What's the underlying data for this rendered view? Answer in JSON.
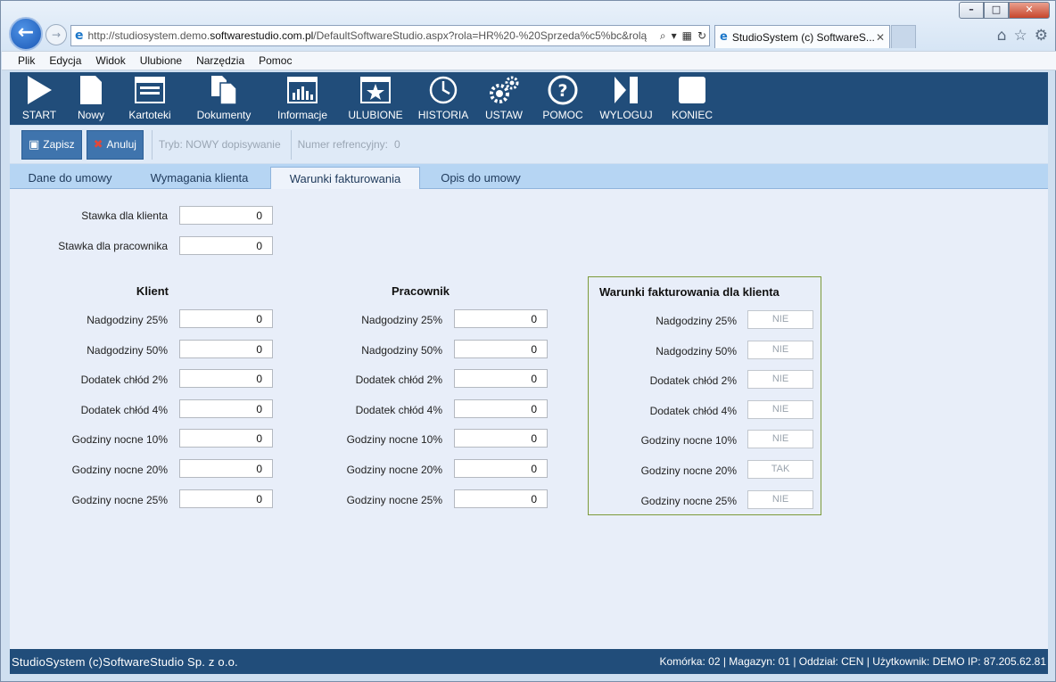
{
  "browser": {
    "url_prefix": "http://studiosystem.demo.",
    "url_domain": "softwarestudio.com.pl",
    "url_path": "/DefaultSoftwareStudio.aspx?rola=HR%20-%20Sprzeda%c5%bc&rolą",
    "tab_title": "StudioSystem (c) SoftwareS...",
    "menu": [
      "Plik",
      "Edycja",
      "Widok",
      "Ulubione",
      "Narzędzia",
      "Pomoc"
    ]
  },
  "toolbar": {
    "items": [
      "START",
      "Nowy",
      "Kartoteki",
      "Dokumenty",
      "Informacje",
      "ULUBIONE",
      "HISTORIA",
      "USTAW",
      "POMOC",
      "WYLOGUJ",
      "KONIEC"
    ],
    "icons": [
      "play-icon",
      "new-document-icon",
      "window-icon",
      "documents-icon",
      "chart-icon",
      "star-icon",
      "history-icon",
      "gears-icon",
      "help-icon",
      "logout-icon",
      "stop-icon"
    ]
  },
  "actions": {
    "save_label": "Zapisz",
    "cancel_label": "Anuluj",
    "mode": "Tryb: NOWY dopisywanie",
    "ref": "Numer refrencyjny:",
    "ref_value": "0"
  },
  "tabs": [
    "Dane do umowy",
    "Wymagania klienta",
    "Warunki fakturowania",
    "Opis do umowy"
  ],
  "active_tab": "Warunki fakturowania",
  "form": {
    "stawka_klienta_label": "Stawka dla klienta",
    "stawka_klienta": "0",
    "stawka_pracownika_label": "Stawka dla pracownika",
    "stawka_pracownika": "0",
    "klient_title": "Klient",
    "pracownik_title": "Pracownik",
    "warunki_title": "Warunki fakturowania dla klienta",
    "row_labels": [
      "Nadgodziny 25%",
      "Nadgodziny 50%",
      "Dodatek chłód 2%",
      "Dodatek chłód 4%",
      "Godziny nocne 10%",
      "Godziny nocne 20%",
      "Godziny nocne 25%"
    ],
    "klient_values": [
      "0",
      "0",
      "0",
      "0",
      "0",
      "0",
      "0"
    ],
    "pracownik_values": [
      "0",
      "0",
      "0",
      "0",
      "0",
      "0",
      "0"
    ],
    "warunki_values": [
      "NIE",
      "NIE",
      "NIE",
      "NIE",
      "NIE",
      "TAK",
      "NIE"
    ]
  },
  "footer": {
    "left": "StudioSystem (c)SoftwareStudio Sp. z o.o.",
    "right": "Komórka: 02 | Magazyn: 01 | Oddział: CEN | Użytkownik: DEMO IP: 87.205.62.81"
  }
}
